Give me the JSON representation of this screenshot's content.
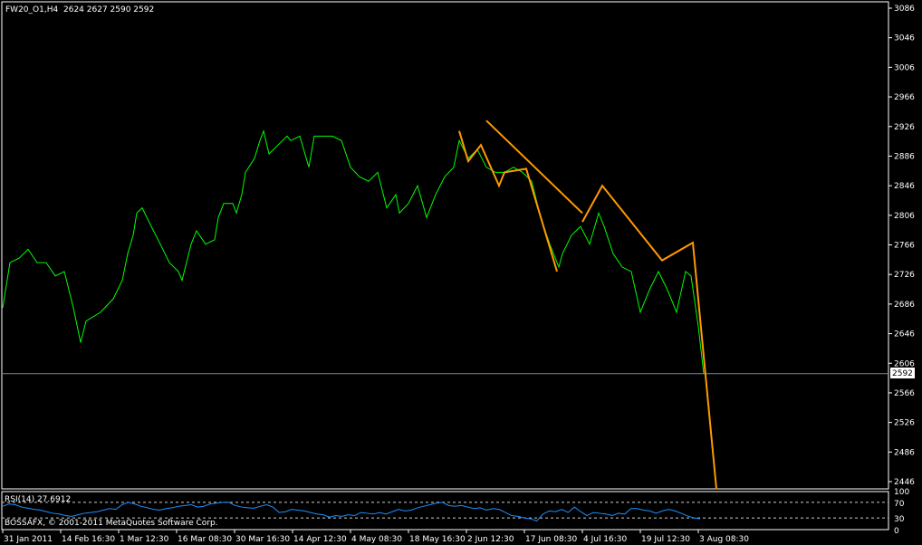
{
  "header": {
    "symbol": "FW20_O1,H4",
    "ohlc": "2624 2627 2590 2592"
  },
  "rsi_label": "RSI(14) 27.6912",
  "copyright": "BOSSAFX, © 2001-2011 MetaQuotes Software Corp.",
  "current_price_label": "2592",
  "colors": {
    "background": "#000000",
    "price_line": "#00ff00",
    "trend_lines": "#ff9900",
    "rsi_line": "#1e90ff",
    "axis": "#ffffff",
    "bid_line": "#778899"
  },
  "chart_data": [
    {
      "type": "line",
      "title": "FW20_O1,H4",
      "ylim": [
        2446,
        3086
      ],
      "yticks": [
        3086,
        3046,
        3006,
        2966,
        2926,
        2886,
        2846,
        2806,
        2766,
        2726,
        2686,
        2646,
        2606,
        2566,
        2526,
        2486,
        2446
      ],
      "xtick_labels": [
        "31 Jan 2011",
        "14 Feb 16:30",
        "1 Mar 12:30",
        "16 Mar 08:30",
        "30 Mar 16:30",
        "14 Apr 12:30",
        "4 May 08:30",
        "18 May 16:30",
        "2 Jun 12:30",
        "17 Jun 08:30",
        "4 Jul 16:30",
        "19 Jul 12:30",
        "3 Aug 08:30"
      ],
      "xtick_bars": [
        0,
        32,
        64,
        96,
        128,
        160,
        192,
        224,
        256,
        288,
        320,
        352,
        384
      ],
      "bid_price": 2592,
      "series": [
        {
          "name": "Close",
          "points": [
            [
              0,
              2681
            ],
            [
              4,
              2742
            ],
            [
              9,
              2748
            ],
            [
              14,
              2760
            ],
            [
              19,
              2742
            ],
            [
              24,
              2742
            ],
            [
              29,
              2724
            ],
            [
              34,
              2730
            ],
            [
              39,
              2681
            ],
            [
              43,
              2634
            ],
            [
              46,
              2663
            ],
            [
              54,
              2675
            ],
            [
              61,
              2693
            ],
            [
              66,
              2718
            ],
            [
              69,
              2754
            ],
            [
              72,
              2779
            ],
            [
              74,
              2809
            ],
            [
              77,
              2816
            ],
            [
              82,
              2791
            ],
            [
              87,
              2767
            ],
            [
              92,
              2742
            ],
            [
              97,
              2730
            ],
            [
              99,
              2718
            ],
            [
              104,
              2767
            ],
            [
              107,
              2785
            ],
            [
              112,
              2767
            ],
            [
              117,
              2773
            ],
            [
              119,
              2803
            ],
            [
              122,
              2822
            ],
            [
              127,
              2822
            ],
            [
              129,
              2809
            ],
            [
              132,
              2834
            ],
            [
              134,
              2864
            ],
            [
              139,
              2883
            ],
            [
              142,
              2907
            ],
            [
              144,
              2920
            ],
            [
              147,
              2889
            ],
            [
              152,
              2901
            ],
            [
              157,
              2913
            ],
            [
              159,
              2907
            ],
            [
              164,
              2913
            ],
            [
              169,
              2871
            ],
            [
              172,
              2913
            ],
            [
              177,
              2913
            ],
            [
              182,
              2913
            ],
            [
              187,
              2907
            ],
            [
              192,
              2871
            ],
            [
              197,
              2858
            ],
            [
              202,
              2852
            ],
            [
              207,
              2864
            ],
            [
              212,
              2816
            ],
            [
              217,
              2834
            ],
            [
              219,
              2809
            ],
            [
              224,
              2822
            ],
            [
              229,
              2846
            ],
            [
              234,
              2803
            ],
            [
              239,
              2834
            ],
            [
              244,
              2858
            ],
            [
              249,
              2871
            ],
            [
              252,
              2907
            ],
            [
              257,
              2883
            ],
            [
              262,
              2895
            ],
            [
              267,
              2871
            ],
            [
              272,
              2864
            ],
            [
              277,
              2864
            ],
            [
              282,
              2871
            ],
            [
              287,
              2864
            ],
            [
              292,
              2852
            ],
            [
              297,
              2803
            ],
            [
              302,
              2767
            ],
            [
              307,
              2736
            ],
            [
              309,
              2754
            ],
            [
              314,
              2779
            ],
            [
              319,
              2791
            ],
            [
              324,
              2767
            ],
            [
              329,
              2809
            ],
            [
              332,
              2791
            ],
            [
              337,
              2754
            ],
            [
              342,
              2736
            ],
            [
              347,
              2730
            ],
            [
              352,
              2675
            ],
            [
              357,
              2705
            ],
            [
              362,
              2730
            ],
            [
              367,
              2705
            ],
            [
              372,
              2675
            ],
            [
              377,
              2730
            ],
            [
              380,
              2724
            ],
            [
              384,
              2656
            ],
            [
              387,
              2592
            ]
          ]
        },
        {
          "name": "Trend line 1",
          "points": [
            [
              252,
              2920
            ],
            [
              257,
              2879
            ],
            [
              264,
              2901
            ],
            [
              274,
              2846
            ],
            [
              277,
              2864
            ],
            [
              289,
              2869
            ],
            [
              306,
              2730
            ]
          ]
        },
        {
          "name": "Trend line 2",
          "points": [
            [
              267,
              2934
            ],
            [
              320,
              2809
            ]
          ]
        },
        {
          "name": "Trend line 3",
          "points": [
            [
              320,
              2797
            ],
            [
              331,
              2846
            ],
            [
              364,
              2745
            ],
            [
              381,
              2769
            ],
            [
              394,
              2436
            ]
          ]
        }
      ]
    },
    {
      "type": "line",
      "title": "RSI(14) 27.6912",
      "ylim": [
        0,
        100
      ],
      "yticks": [
        100,
        70,
        30,
        0
      ],
      "levels": [
        70,
        30
      ],
      "series": [
        {
          "name": "RSI(14)",
          "values": [
            60,
            66,
            64,
            58,
            55,
            52,
            50,
            46,
            42,
            40,
            36,
            34,
            38,
            42,
            44,
            46,
            50,
            54,
            52,
            64,
            70,
            66,
            60,
            56,
            52,
            50,
            54,
            56,
            60,
            62,
            64,
            58,
            60,
            66,
            68,
            70,
            70,
            62,
            58,
            56,
            55,
            60,
            64,
            58,
            44,
            46,
            52,
            50,
            48,
            44,
            40,
            38,
            32,
            36,
            34,
            38,
            36,
            44,
            42,
            40,
            44,
            40,
            46,
            52,
            48,
            50,
            56,
            60,
            64,
            68,
            70,
            62,
            60,
            62,
            58,
            54,
            56,
            50,
            54,
            52,
            44,
            36,
            34,
            30,
            28,
            22,
            40,
            48,
            46,
            52,
            44,
            58,
            46,
            36,
            44,
            42,
            40,
            36,
            42,
            40,
            54,
            54,
            50,
            48,
            42,
            48,
            52,
            48,
            42,
            35,
            30,
            28
          ]
        }
      ]
    }
  ]
}
